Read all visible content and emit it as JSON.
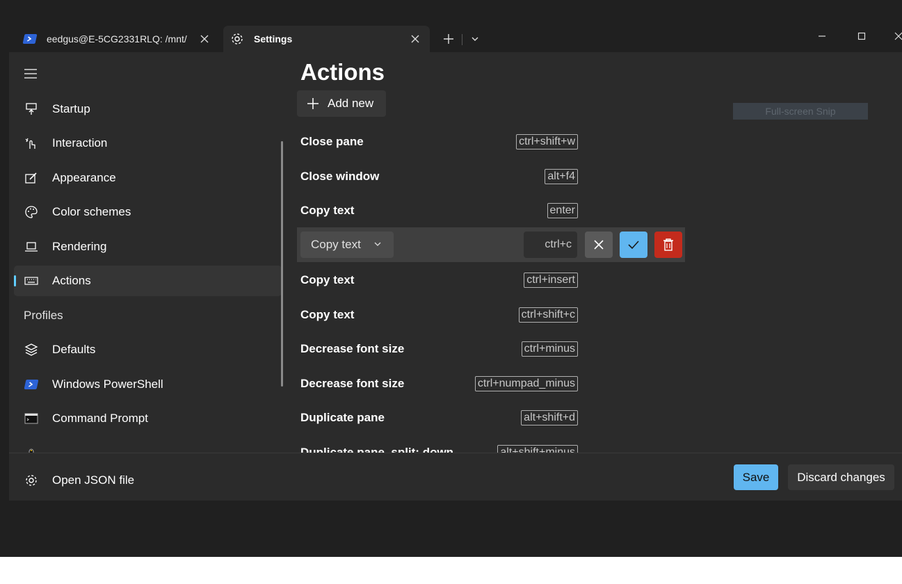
{
  "tabs": [
    {
      "label": "eedgus@E-5CG2331RLQ: /mnt/",
      "icon": "powershell-icon"
    },
    {
      "label": "Settings",
      "icon": "gear-icon"
    }
  ],
  "nav": {
    "items": [
      {
        "label": "Startup",
        "icon": "startup-icon"
      },
      {
        "label": "Interaction",
        "icon": "interaction-icon"
      },
      {
        "label": "Appearance",
        "icon": "appearance-icon"
      },
      {
        "label": "Color schemes",
        "icon": "palette-icon"
      },
      {
        "label": "Rendering",
        "icon": "laptop-icon"
      },
      {
        "label": "Actions",
        "icon": "keyboard-icon"
      }
    ],
    "profiles_header": "Profiles",
    "profiles": [
      {
        "label": "Defaults",
        "icon": "layers-icon"
      },
      {
        "label": "Windows PowerShell",
        "icon": "powershell-icon"
      },
      {
        "label": "Command Prompt",
        "icon": "cmd-icon"
      }
    ],
    "open_json": "Open JSON file"
  },
  "page": {
    "title": "Actions",
    "add_new": "Add new",
    "actions": [
      {
        "name": "Close pane",
        "keys": "ctrl+shift+w"
      },
      {
        "name": "Close window",
        "keys": "alt+f4"
      },
      {
        "name": "Copy text",
        "keys": "enter"
      },
      {
        "name": "Copy text",
        "keys": "ctrl+insert"
      },
      {
        "name": "Copy text",
        "keys": "ctrl+shift+c"
      },
      {
        "name": "Decrease font size",
        "keys": "ctrl+minus"
      },
      {
        "name": "Decrease font size",
        "keys": "ctrl+numpad_minus"
      },
      {
        "name": "Duplicate pane",
        "keys": "alt+shift+d"
      },
      {
        "name": "Duplicate pane, split: down",
        "keys": "alt+shift+minus"
      }
    ],
    "editing": {
      "action": "Copy text",
      "keys": "ctrl+c"
    }
  },
  "overlay": {
    "snip_text": "Full-screen Snip"
  },
  "footer": {
    "save": "Save",
    "discard": "Discard changes"
  },
  "colors": {
    "accent": "#60b6f0",
    "danger": "#c42b1c",
    "selected_indicator": "#60cdff",
    "background": "#2b2b2b"
  }
}
